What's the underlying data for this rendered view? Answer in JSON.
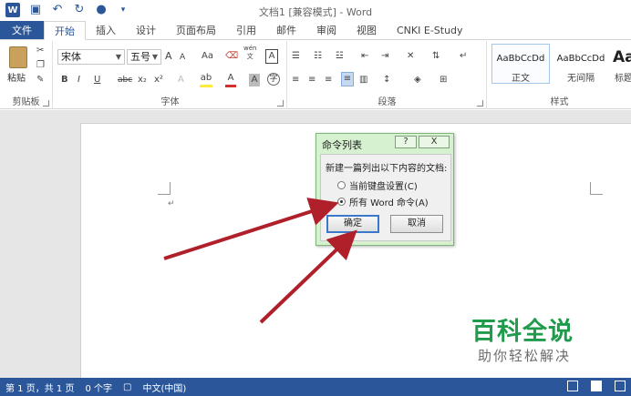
{
  "title": {
    "window_title": "文档1 [兼容模式] - Word",
    "logo_letter": "W"
  },
  "tabs": {
    "file": "文件",
    "items": [
      "开始",
      "插入",
      "设计",
      "页面布局",
      "引用",
      "邮件",
      "审阅",
      "视图",
      "CNKI E-Study"
    ]
  },
  "ribbon": {
    "clipboard": {
      "paste": "粘贴",
      "label": "剪贴板"
    },
    "font": {
      "name": "宋体",
      "size": "五号",
      "bold": "B",
      "italic": "I",
      "underline": "U",
      "strike": "abc",
      "sub": "x₂",
      "sup": "x²",
      "grow": "A",
      "shrink": "A",
      "case": "Aa",
      "wen": "wén",
      "wen_sub": "文",
      "border_a": "A",
      "label": "字体"
    },
    "paragraph": {
      "label": "段落"
    },
    "styles": {
      "items": [
        {
          "sample": "AaBbCcDd",
          "name": "正文"
        },
        {
          "sample": "AaBbCcDd",
          "name": "无间隔"
        },
        {
          "sample": "Aa",
          "name": "标题"
        }
      ],
      "label": "样式"
    }
  },
  "dialog": {
    "title": "命令列表",
    "help": "?",
    "close": "X",
    "prompt": "新建一篇列出以下内容的文档:",
    "options": [
      {
        "label": "当前键盘设置(C)",
        "selected": false
      },
      {
        "label": "所有 Word 命令(A)",
        "selected": true
      }
    ],
    "ok": "确定",
    "cancel": "取消"
  },
  "watermark": {
    "main": "百科全说",
    "sub": "助你轻松解决"
  },
  "status": {
    "page": "第 1 页，共 1 页",
    "words": "0 个字",
    "lang": "中文(中国)"
  },
  "colors": {
    "accent": "#2b579a",
    "dialog_bg": "#d6f1d0",
    "arrow": "#b0202a",
    "watermark": "#1f9b4b"
  }
}
